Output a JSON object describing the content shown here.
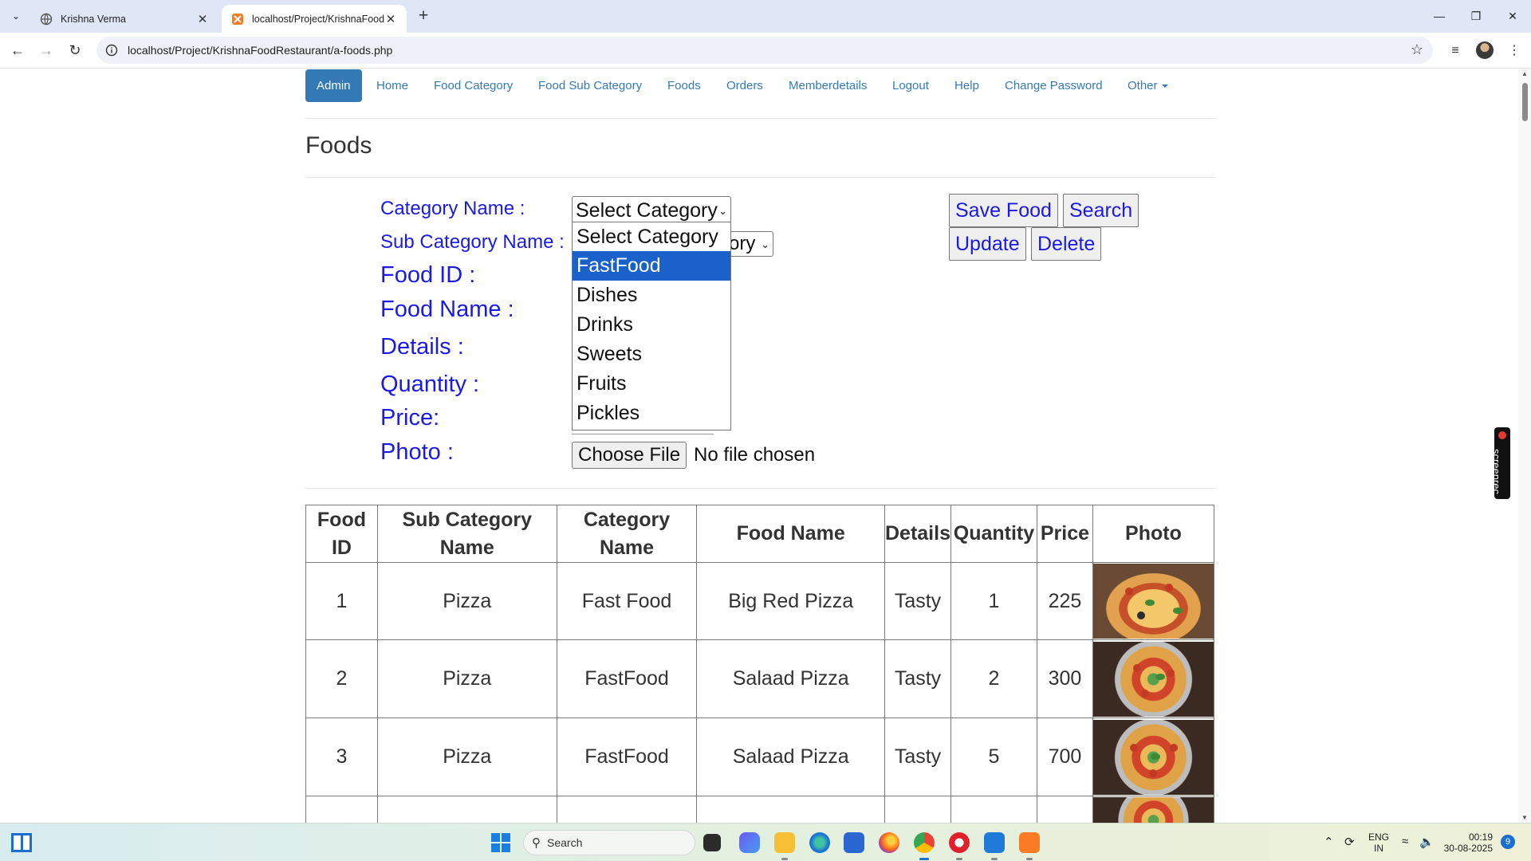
{
  "browser": {
    "tabs": [
      {
        "title": "Krishna Verma",
        "active": false
      },
      {
        "title": "localhost/Project/KrishnaFoodR",
        "active": true
      }
    ],
    "url": "localhost/Project/KrishnaFoodRestaurant/a-foods.php"
  },
  "nav": {
    "items": [
      {
        "label": "Admin",
        "active": true
      },
      {
        "label": "Home"
      },
      {
        "label": "Food Category"
      },
      {
        "label": "Food Sub Category"
      },
      {
        "label": "Foods"
      },
      {
        "label": "Orders"
      },
      {
        "label": "Memberdetails"
      },
      {
        "label": "Logout"
      },
      {
        "label": "Help"
      },
      {
        "label": "Change Password"
      },
      {
        "label": "Other"
      }
    ]
  },
  "page": {
    "title": "Foods"
  },
  "form": {
    "labels": {
      "category": "Category Name :",
      "subcategory": "Sub Category Name :",
      "food_id": "Food ID :",
      "food_name": "Food Name :",
      "details": "Details :",
      "quantity": "Quantity :",
      "price": "Price:",
      "photo": "Photo :"
    },
    "category_select": {
      "value": "Select Category",
      "options": [
        "Select Category",
        "FastFood",
        "Dishes",
        "Drinks",
        "Sweets",
        "Fruits",
        "Pickles"
      ],
      "highlighted": "FastFood"
    },
    "subcategory_select_visible": "ory",
    "buttons": {
      "save": "Save Food",
      "search": "Search",
      "update": "Update",
      "delete": "Delete"
    },
    "file": {
      "button": "Choose File",
      "status": "No file chosen"
    }
  },
  "table": {
    "headers": [
      {
        "line1": "Food",
        "line2": "ID"
      },
      {
        "line1": "Sub Category",
        "line2": "Name"
      },
      {
        "line1": "Category",
        "line2": "Name"
      },
      {
        "line1": "Food Name",
        "line2": ""
      },
      {
        "line1": "Details",
        "line2": ""
      },
      {
        "line1": "Quantity",
        "line2": ""
      },
      {
        "line1": "Price",
        "line2": ""
      },
      {
        "line1": "Photo",
        "line2": ""
      }
    ],
    "rows": [
      {
        "id": "1",
        "sub": "Pizza",
        "cat": "Fast Food",
        "name": "Big Red Pizza",
        "details": "Tasty",
        "qty": "1",
        "price": "225"
      },
      {
        "id": "2",
        "sub": "Pizza",
        "cat": "FastFood",
        "name": "Salaad Pizza",
        "details": "Tasty",
        "qty": "2",
        "price": "300"
      },
      {
        "id": "3",
        "sub": "Pizza",
        "cat": "FastFood",
        "name": "Salaad Pizza",
        "details": "Tasty",
        "qty": "5",
        "price": "700"
      }
    ]
  },
  "extension": {
    "label": "screenrec"
  },
  "taskbar": {
    "search_placeholder": "Search",
    "lang1": "ENG",
    "lang2": "IN",
    "time": "00:19",
    "date": "30-08-2025",
    "notifications": "9"
  },
  "colors": {
    "link": "#337ab7",
    "form_label": "#1a1ae6",
    "highlight": "#1a61c9"
  }
}
